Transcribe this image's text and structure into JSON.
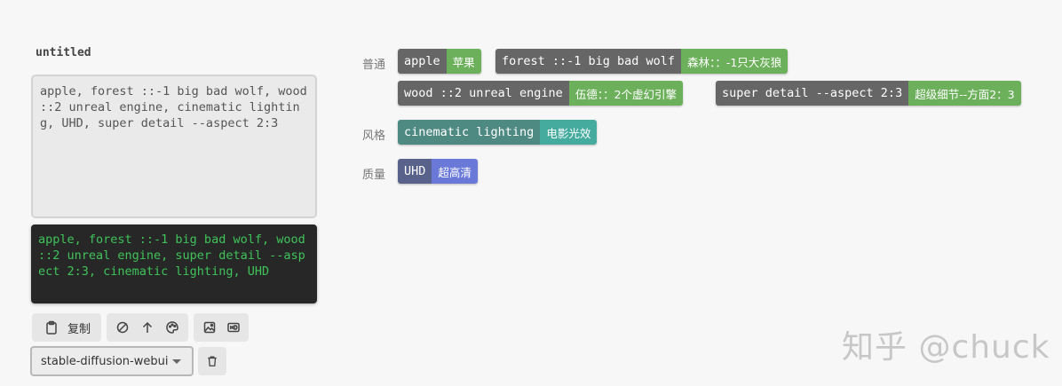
{
  "panel": {
    "title": "untitled",
    "prompt_text": "apple, forest ::-1 big bad wolf, wood ::2 unreal engine, cinematic lighting, UHD, super detail --aspect 2:3",
    "output_text": "apple, forest ::-1 big bad wolf, wood ::2 unreal engine, super detail --aspect 2:3, cinematic lighting, UHD",
    "copy_label": "复制",
    "engine_select": "stable-diffusion-webui"
  },
  "categories": [
    {
      "label": "普通",
      "tags": [
        {
          "en": "apple",
          "zh": "苹果"
        },
        {
          "en": "forest ::-1 big bad wolf",
          "zh": "森林：：-1只大灰狼"
        },
        {
          "en": "wood ::2 unreal engine",
          "zh": "伍德：：2个虚幻引擎"
        },
        {
          "en": "super detail --aspect 2:3",
          "zh": "超级细节--方面2：3"
        }
      ]
    },
    {
      "label": "风格",
      "tags": [
        {
          "en": "cinematic lighting",
          "zh": "电影光效"
        }
      ]
    },
    {
      "label": "质量",
      "tags": [
        {
          "en": "UHD",
          "zh": "超高清"
        }
      ]
    }
  ],
  "watermark": "知乎 @chuck",
  "colors": {
    "tag_en_bg": "#666666",
    "tag_zh_normal": "#6db05b",
    "tag_zh_style": "#45ab9f",
    "tag_zh_quality": "#6a79d8",
    "output_bg": "#272727",
    "output_text": "#3fc35a"
  }
}
